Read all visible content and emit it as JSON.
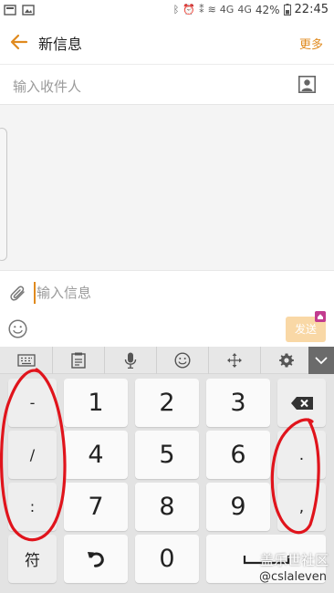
{
  "status_bar": {
    "battery_text": "42%",
    "time": "22:45",
    "net1": "4G",
    "net2": "4G"
  },
  "header": {
    "title": "新信息",
    "more_label": "更多"
  },
  "recipient": {
    "placeholder": "输入收件人"
  },
  "compose": {
    "placeholder": "输入信息",
    "send_label": "发送"
  },
  "keyboard": {
    "tools": [
      "keyboard-icon",
      "clipboard-icon",
      "microphone-icon",
      "emoji-icon",
      "move-icon",
      "gear-icon",
      "chevron-down-icon"
    ],
    "left_keys": [
      "-",
      "/",
      ":",
      "符"
    ],
    "digits": [
      "1",
      "2",
      "3",
      "4",
      "5",
      "6",
      "7",
      "8",
      "9",
      "0"
    ],
    "right_keys": [
      ".",
      ","
    ],
    "icons": [
      "backspace-icon",
      "undo-icon",
      "space-icon"
    ]
  },
  "watermark": {
    "line1": "盖乐世社区",
    "line2": "@cslaleven"
  },
  "colors": {
    "accent": "#e08a1e",
    "send_disabled": "#f9d8a6",
    "annotation": "#e0141c"
  }
}
